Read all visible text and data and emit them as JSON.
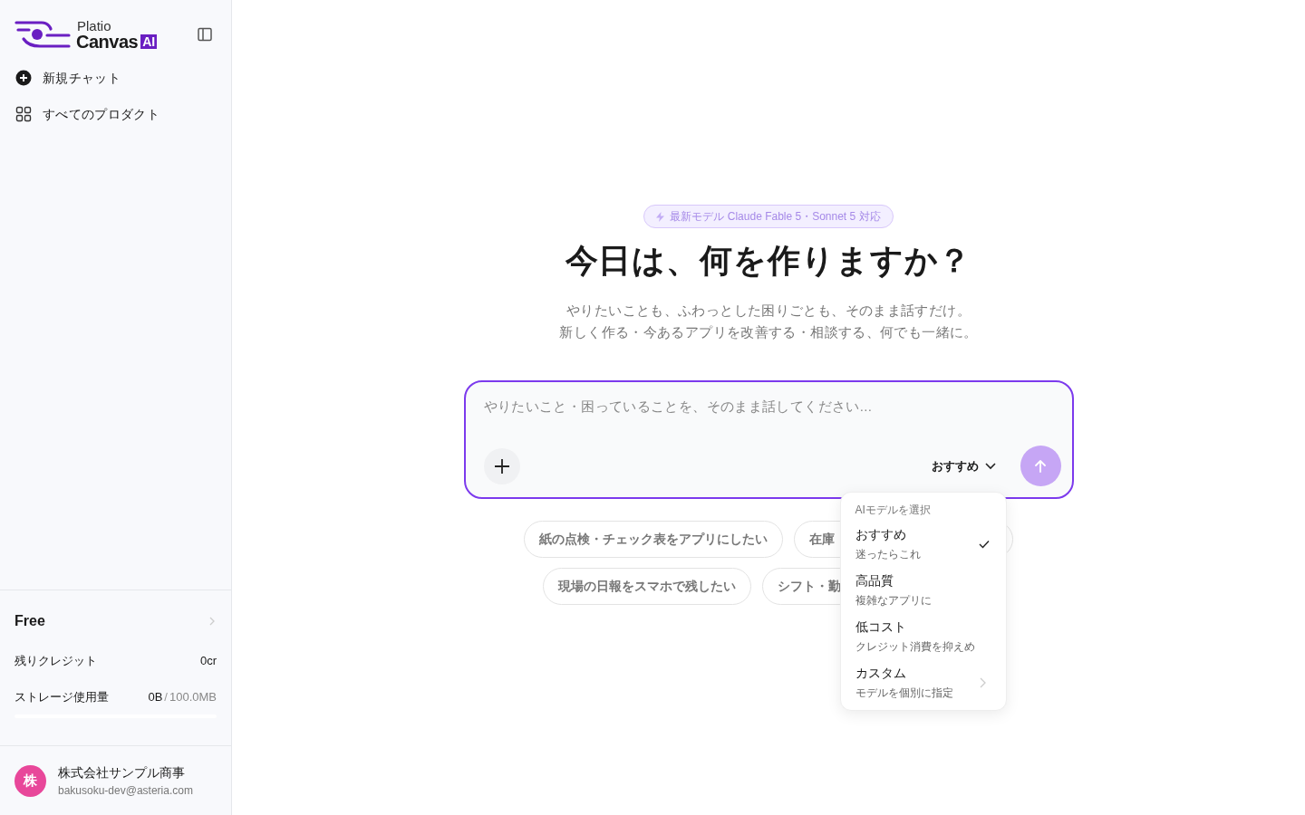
{
  "logo": {
    "top": "Platio",
    "main": "Canvas",
    "badge": "AI"
  },
  "sidebar": {
    "items": [
      {
        "kind": "new",
        "label": "新規チャット"
      },
      {
        "kind": "grid",
        "label": "すべてのプロダクト"
      }
    ]
  },
  "plan": {
    "name": "Free",
    "credits_label": "残りクレジット",
    "credits": "0cr",
    "storage_label": "ストレージ使用量",
    "storage_used": "0B",
    "storage_sep": "/",
    "storage_total": "100.0MB",
    "level": 0
  },
  "user": {
    "avatar": "株",
    "name": "株式会社サンプル商事",
    "email": "bakusoku-dev@asteria.com"
  },
  "badge": "最新モデル Claude Fable 5・Sonnet 5 対応",
  "heading": "今日は、何を作りますか？",
  "subtitle": [
    "やりたいことも、ふわっとした困りごとも、そのまま話すだけ。",
    "新しく作る・今あるアプリを改善する・相談する、何でも一緒に。"
  ],
  "input": {
    "placeholder": "やりたいこと・困っていることを、そのまま話してください...",
    "model": "おすすめ"
  },
  "suggestions": [
    "紙の点検・チェック表をアプリにしたい",
    "在庫",
    "現場の日報をスマホで残したい",
    "シフト・勤"
  ],
  "model_menu": {
    "title": "AIモデルを選択",
    "options": [
      {
        "label": "おすすめ",
        "desc": "迷ったらこれ",
        "selected": true,
        "submenu": false
      },
      {
        "label": "高品質",
        "desc": "複雑なアプリに",
        "selected": false,
        "submenu": false
      },
      {
        "label": "低コスト",
        "desc": "クレジット消費を抑えめ",
        "selected": false,
        "submenu": false
      },
      {
        "label": "カスタム",
        "desc": "モデルを個別に指定",
        "selected": false,
        "submenu": true
      }
    ]
  }
}
